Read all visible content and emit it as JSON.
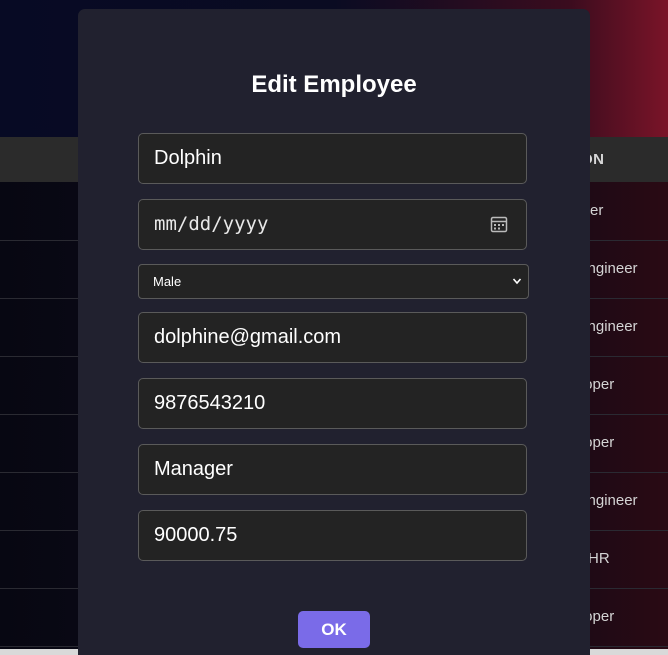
{
  "table": {
    "header_partial": "ITION",
    "rows_partial": [
      "nager",
      "e Engineer",
      "e Engineer",
      "evloper",
      "evloper",
      "e Engineer",
      "HR",
      "evloper"
    ]
  },
  "modal": {
    "title": "Edit Employee",
    "name_value": "Dolphin",
    "date_placeholder": "mm/dd/yyyy",
    "gender_selected": "Male",
    "email_value": "dolphine@gmail.com",
    "phone_value": "9876543210",
    "position_value": "Manager",
    "salary_value": "90000.75",
    "ok_label": "OK"
  },
  "colors": {
    "modal_bg": "#21212f",
    "field_bg": "#232323",
    "ok_button": "#7a6be8"
  }
}
